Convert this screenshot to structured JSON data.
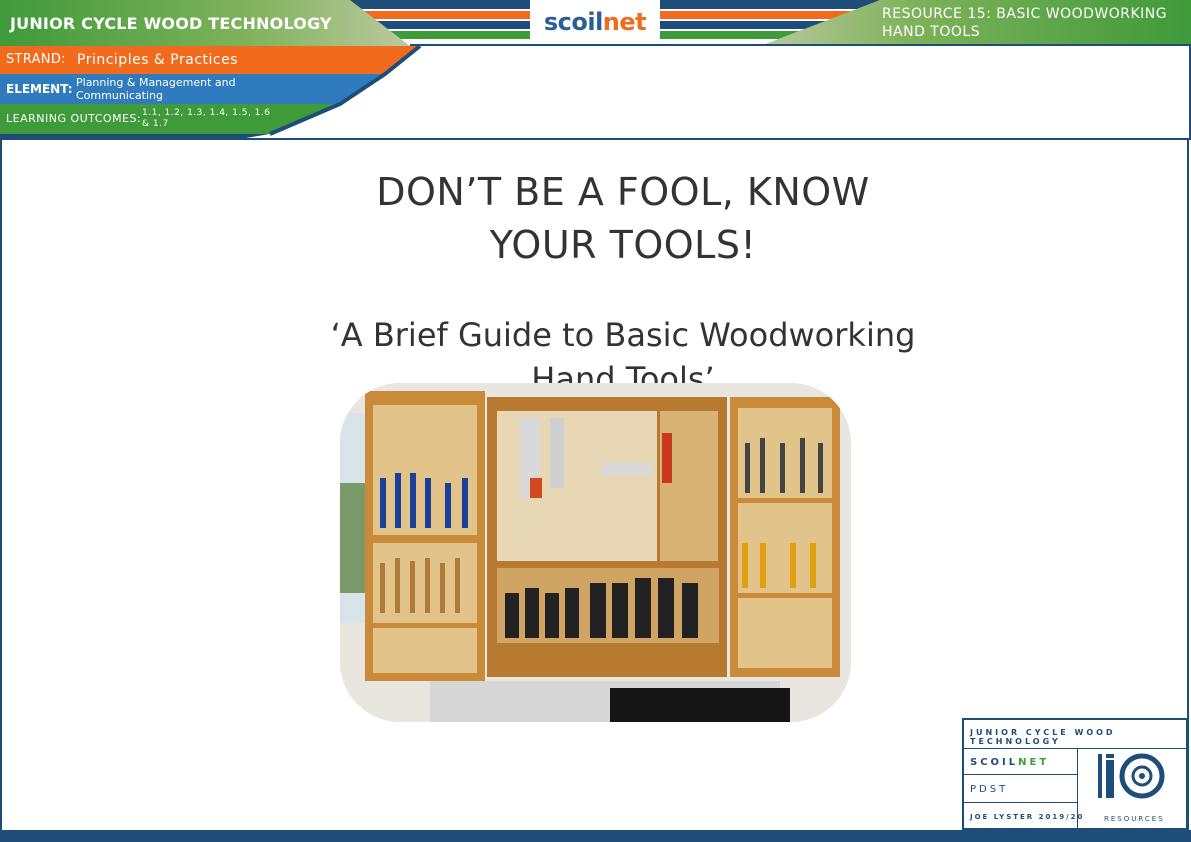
{
  "header": {
    "title": "JUNIOR CYCLE WOOD TECHNOLOGY",
    "resource": "RESOURCE 15: BASIC WOODWORKING HAND TOOLS",
    "logo_left": "scoil",
    "logo_right": "net"
  },
  "ribbons": {
    "strand_label": "STRAND:",
    "strand_value": "Principles & Practices",
    "element_label": "ELEMENT:",
    "element_value": "Planning & Management and Communicating",
    "outcomes_label": "LEARNING OUTCOMES:",
    "outcomes_value": "1.1, 1.2, 1.3, 1.4, 1.5, 1.6 & 1.7"
  },
  "main": {
    "title_line1": "DON’T BE A FOOL, KNOW",
    "title_line2": "YOUR TOOLS!",
    "subtitle_line1": "‘A Brief Guide to Basic Woodworking",
    "subtitle_line2": "Hand Tools’"
  },
  "footer_box": {
    "junior_cycle": "JUNIOR CYCLE WOOD TECHNOLOGY",
    "scoil": "SCOIL",
    "net": "NET",
    "pdst": "PDST",
    "author": "JOE LYSTER 2019/20",
    "resources": "RESOURCES"
  },
  "colors": {
    "navy": "#1e4d7a",
    "green": "#4caf50",
    "orange": "#f26a1b",
    "blue": "#2f7bbd"
  }
}
